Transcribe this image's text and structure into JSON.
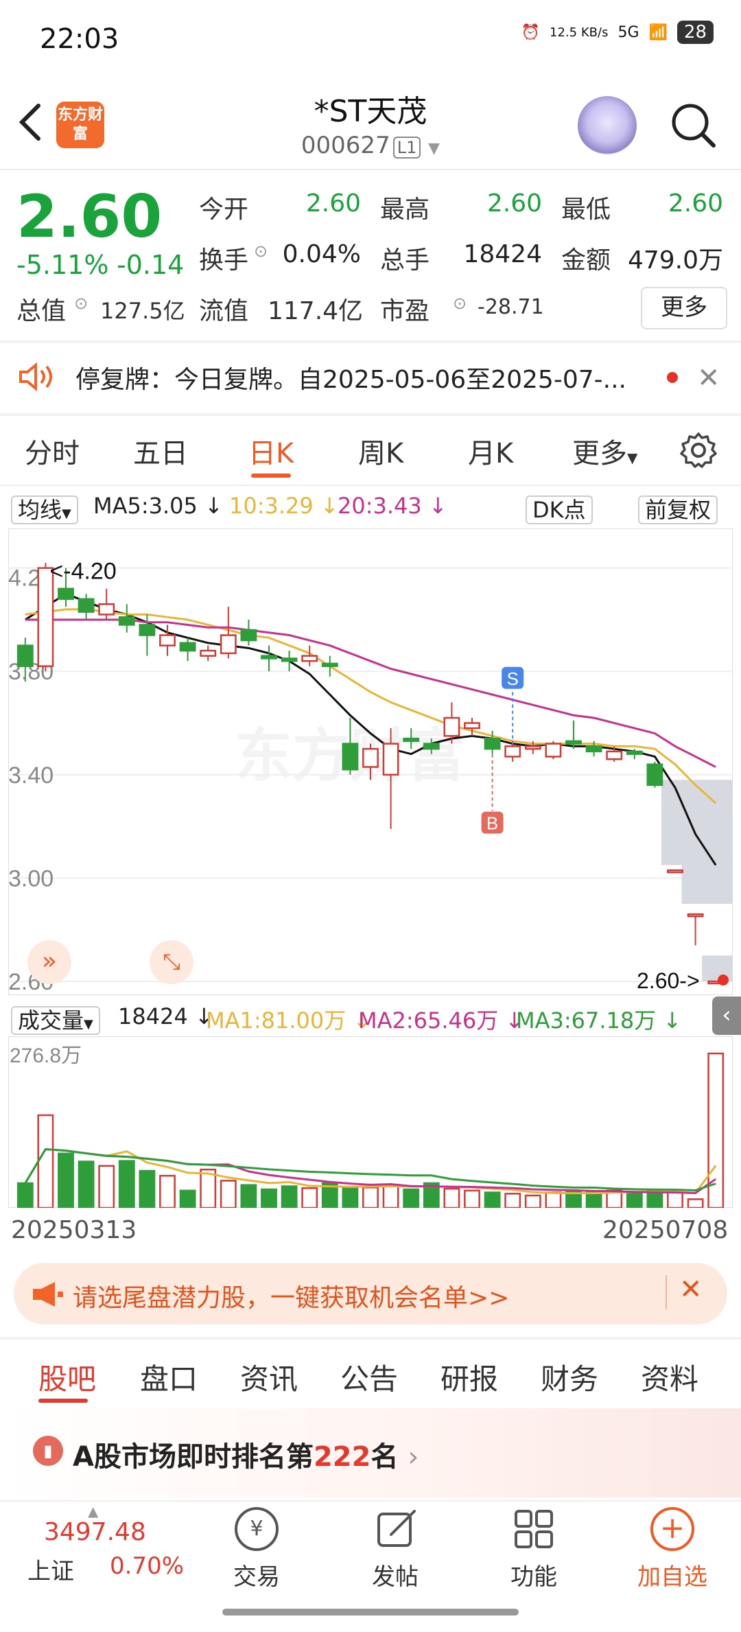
{
  "status": {
    "time": "22:03",
    "net_speed": "12.5 KB/s",
    "signal": "5G",
    "battery": "28"
  },
  "header": {
    "logo": "东方财富",
    "stock_name": "*ST天茂",
    "stock_code": "000627",
    "code_tag": "L1"
  },
  "quote": {
    "price": "2.60",
    "change_pct": "-5.11%",
    "change": "-0.14",
    "rows": [
      [
        {
          "label": "今开",
          "value": "2.60"
        },
        {
          "label": "最高",
          "value": "2.60"
        },
        {
          "label": "最低",
          "value": "2.60"
        }
      ],
      [
        {
          "label": "换手",
          "value": "0.04%"
        },
        {
          "label": "总手",
          "value": "18424"
        },
        {
          "label": "金额",
          "value": "479.0万"
        }
      ],
      [
        {
          "label": "总值",
          "value": "127.5亿"
        },
        {
          "label": "流值",
          "value": "117.4亿"
        },
        {
          "label": "市盈",
          "value": "-28.71"
        }
      ]
    ],
    "more": "更多"
  },
  "notice": {
    "text": "停复牌：今日复牌。自2025-05-06至2025-07-..."
  },
  "ktabs": [
    "分时",
    "五日",
    "日K",
    "周K",
    "月K",
    "更多"
  ],
  "ma": {
    "label": "均线",
    "ma5": "MA5:3.05 ↓",
    "ma10": "10:3.29 ↓",
    "ma20": "20:3.43 ↓",
    "dk": "DK点",
    "fq": "前复权"
  },
  "vol": {
    "label": "成交量",
    "value": "18424 ↓",
    "ma1": "MA1:81.00万 ↓",
    "ma2": "MA2:65.46万 ↓",
    "ma3": "MA3:67.18万 ↓",
    "max": "276.8万"
  },
  "chart_data": {
    "type": "candlestick",
    "y_ticks": [
      "4.20",
      "3.80",
      "3.40",
      "3.00",
      "2.60"
    ],
    "ylim": [
      2.6,
      4.3
    ],
    "max_label": "4.20",
    "last_label": "2.60",
    "start_date": "20250313",
    "end_date": "20250708",
    "markers": [
      "S",
      "B"
    ],
    "candles": [
      {
        "o": 3.9,
        "c": 3.82,
        "h": 3.93,
        "l": 3.76
      },
      {
        "o": 3.82,
        "c": 4.2,
        "h": 4.22,
        "l": 3.8
      },
      {
        "o": 4.12,
        "c": 4.08,
        "h": 4.2,
        "l": 4.05
      },
      {
        "o": 4.08,
        "c": 4.03,
        "h": 4.1,
        "l": 4.0
      },
      {
        "o": 4.02,
        "c": 4.06,
        "h": 4.12,
        "l": 4.0
      },
      {
        "o": 4.01,
        "c": 3.98,
        "h": 4.06,
        "l": 3.95
      },
      {
        "o": 3.98,
        "c": 3.94,
        "h": 4.02,
        "l": 3.86
      },
      {
        "o": 3.9,
        "c": 3.94,
        "h": 3.98,
        "l": 3.86
      },
      {
        "o": 3.91,
        "c": 3.88,
        "h": 3.93,
        "l": 3.84
      },
      {
        "o": 3.86,
        "c": 3.88,
        "h": 3.9,
        "l": 3.84
      },
      {
        "o": 3.87,
        "c": 3.94,
        "h": 4.05,
        "l": 3.85
      },
      {
        "o": 3.96,
        "c": 3.92,
        "h": 4.0,
        "l": 3.9
      },
      {
        "o": 3.86,
        "c": 3.85,
        "h": 3.9,
        "l": 3.8
      },
      {
        "o": 3.85,
        "c": 3.84,
        "h": 3.88,
        "l": 3.8
      },
      {
        "o": 3.84,
        "c": 3.86,
        "h": 3.9,
        "l": 3.82
      },
      {
        "o": 3.83,
        "c": 3.82,
        "h": 3.86,
        "l": 3.78
      },
      {
        "o": 3.52,
        "c": 3.42,
        "h": 3.62,
        "l": 3.4
      },
      {
        "o": 3.43,
        "c": 3.5,
        "h": 3.52,
        "l": 3.38
      },
      {
        "o": 3.4,
        "c": 3.52,
        "h": 3.58,
        "l": 3.19
      },
      {
        "o": 3.54,
        "c": 3.53,
        "h": 3.58,
        "l": 3.5
      },
      {
        "o": 3.52,
        "c": 3.5,
        "h": 3.54,
        "l": 3.48
      },
      {
        "o": 3.55,
        "c": 3.62,
        "h": 3.68,
        "l": 3.52
      },
      {
        "o": 3.58,
        "c": 3.6,
        "h": 3.62,
        "l": 3.55
      },
      {
        "o": 3.54,
        "c": 3.5,
        "h": 3.57,
        "l": 3.48
      },
      {
        "o": 3.47,
        "c": 3.51,
        "h": 3.53,
        "l": 3.45
      },
      {
        "o": 3.5,
        "c": 3.51,
        "h": 3.53,
        "l": 3.48
      },
      {
        "o": 3.47,
        "c": 3.52,
        "h": 3.53,
        "l": 3.46
      },
      {
        "o": 3.53,
        "c": 3.52,
        "h": 3.61,
        "l": 3.5
      },
      {
        "o": 3.51,
        "c": 3.49,
        "h": 3.53,
        "l": 3.47
      },
      {
        "o": 3.46,
        "c": 3.49,
        "h": 3.51,
        "l": 3.45
      },
      {
        "o": 3.49,
        "c": 3.48,
        "h": 3.5,
        "l": 3.46
      },
      {
        "o": 3.44,
        "c": 3.36,
        "h": 3.45,
        "l": 3.35
      },
      {
        "o": 3.03,
        "c": 3.03,
        "h": 3.03,
        "l": 3.03
      },
      {
        "o": 2.86,
        "c": 2.86,
        "h": 2.86,
        "l": 2.74
      },
      {
        "o": 2.6,
        "c": 2.6,
        "h": 2.6,
        "l": 2.6
      }
    ],
    "ma5": [
      4.0,
      4.05,
      4.1,
      4.07,
      4.04,
      4.02,
      3.99,
      3.95,
      3.93,
      3.91,
      3.9,
      3.89,
      3.87,
      3.84,
      3.79,
      3.71,
      3.63,
      3.56,
      3.5,
      3.48,
      3.52,
      3.54,
      3.55,
      3.54,
      3.52,
      3.51,
      3.52,
      3.51,
      3.51,
      3.5,
      3.49,
      3.47,
      3.35,
      3.17,
      3.05
    ],
    "ma10": [
      4.02,
      4.03,
      4.04,
      4.04,
      4.03,
      4.02,
      4.02,
      4.01,
      4.0,
      3.98,
      3.96,
      3.94,
      3.93,
      3.9,
      3.87,
      3.82,
      3.77,
      3.72,
      3.68,
      3.65,
      3.62,
      3.59,
      3.57,
      3.55,
      3.53,
      3.52,
      3.52,
      3.52,
      3.52,
      3.51,
      3.51,
      3.5,
      3.44,
      3.36,
      3.29
    ],
    "ma20": [
      4.0,
      4.0,
      4.0,
      4.0,
      4.0,
      4.0,
      3.99,
      3.99,
      3.98,
      3.97,
      3.97,
      3.96,
      3.95,
      3.94,
      3.92,
      3.9,
      3.87,
      3.84,
      3.81,
      3.79,
      3.77,
      3.75,
      3.73,
      3.71,
      3.69,
      3.67,
      3.65,
      3.63,
      3.62,
      3.6,
      3.58,
      3.56,
      3.51,
      3.47,
      3.43
    ],
    "volume": [
      40,
      150,
      88,
      75,
      68,
      76,
      60,
      52,
      28,
      62,
      44,
      37,
      30,
      35,
      32,
      40,
      33,
      33,
      37,
      30,
      40,
      31,
      28,
      25,
      23,
      20,
      25,
      26,
      25,
      28,
      26,
      27,
      25,
      14,
      250
    ]
  },
  "promo": {
    "text": "请选尾盘潜力股，一键获取机会名单>>"
  },
  "sections": [
    "股吧",
    "盘口",
    "资讯",
    "公告",
    "研报",
    "财务",
    "资料"
  ],
  "rank": {
    "prefix": "A股市场即时排名第",
    "num": "222",
    "suffix": "名"
  },
  "nav": {
    "index_value": "3497.48",
    "index_name": "上证",
    "index_pct": "0.70%",
    "items": [
      "交易",
      "发帖",
      "功能",
      "加自选"
    ]
  }
}
